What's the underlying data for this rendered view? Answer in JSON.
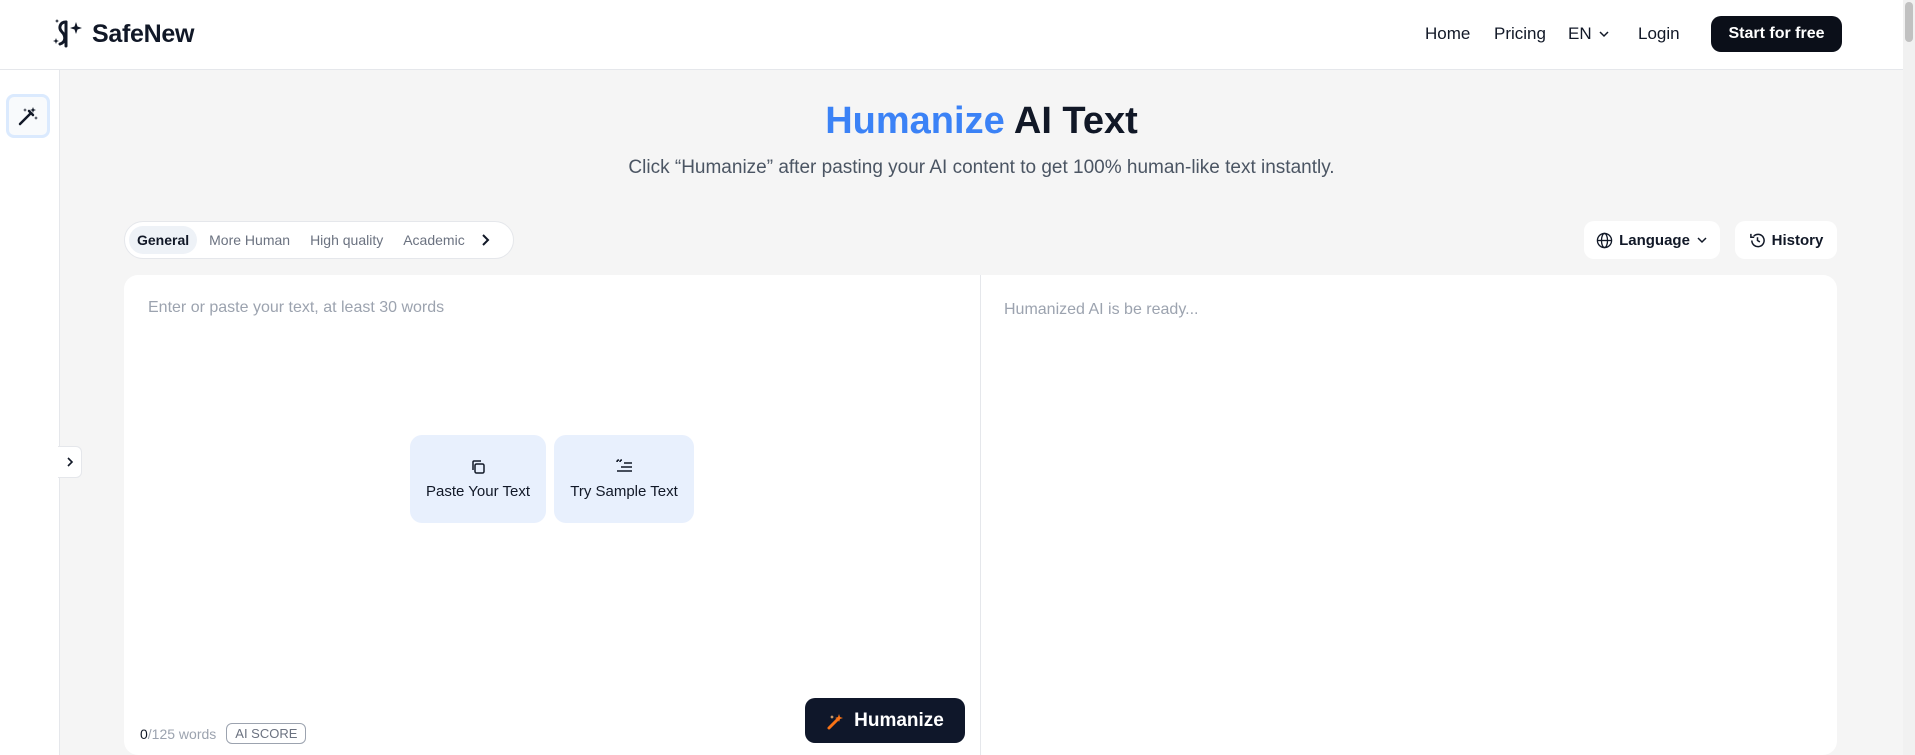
{
  "header": {
    "brand": "SafeNew",
    "nav": {
      "home": "Home",
      "pricing": "Pricing",
      "lang": "EN",
      "login": "Login",
      "start": "Start for free"
    }
  },
  "hero": {
    "title_accent": "Humanize",
    "title_rest": "AI Text",
    "subtitle": "Click “Humanize” after pasting your AI content to get 100% human-like text instantly."
  },
  "modes": [
    "General",
    "More Human",
    "High quality",
    "Academic"
  ],
  "toolbar": {
    "language": "Language",
    "history": "History"
  },
  "editor": {
    "input_placeholder": "Enter or paste your text, at least 30 words",
    "output_placeholder": "Humanized AI is be ready...",
    "paste_label": "Paste Your Text",
    "sample_label": "Try Sample Text",
    "word_count": "0",
    "word_limit": "/125 words",
    "ai_score": "AI SCORE",
    "humanize": "Humanize"
  },
  "colors": {
    "accent": "#3b82f6",
    "dark": "#0f172a",
    "card": "#e8f0fd"
  }
}
